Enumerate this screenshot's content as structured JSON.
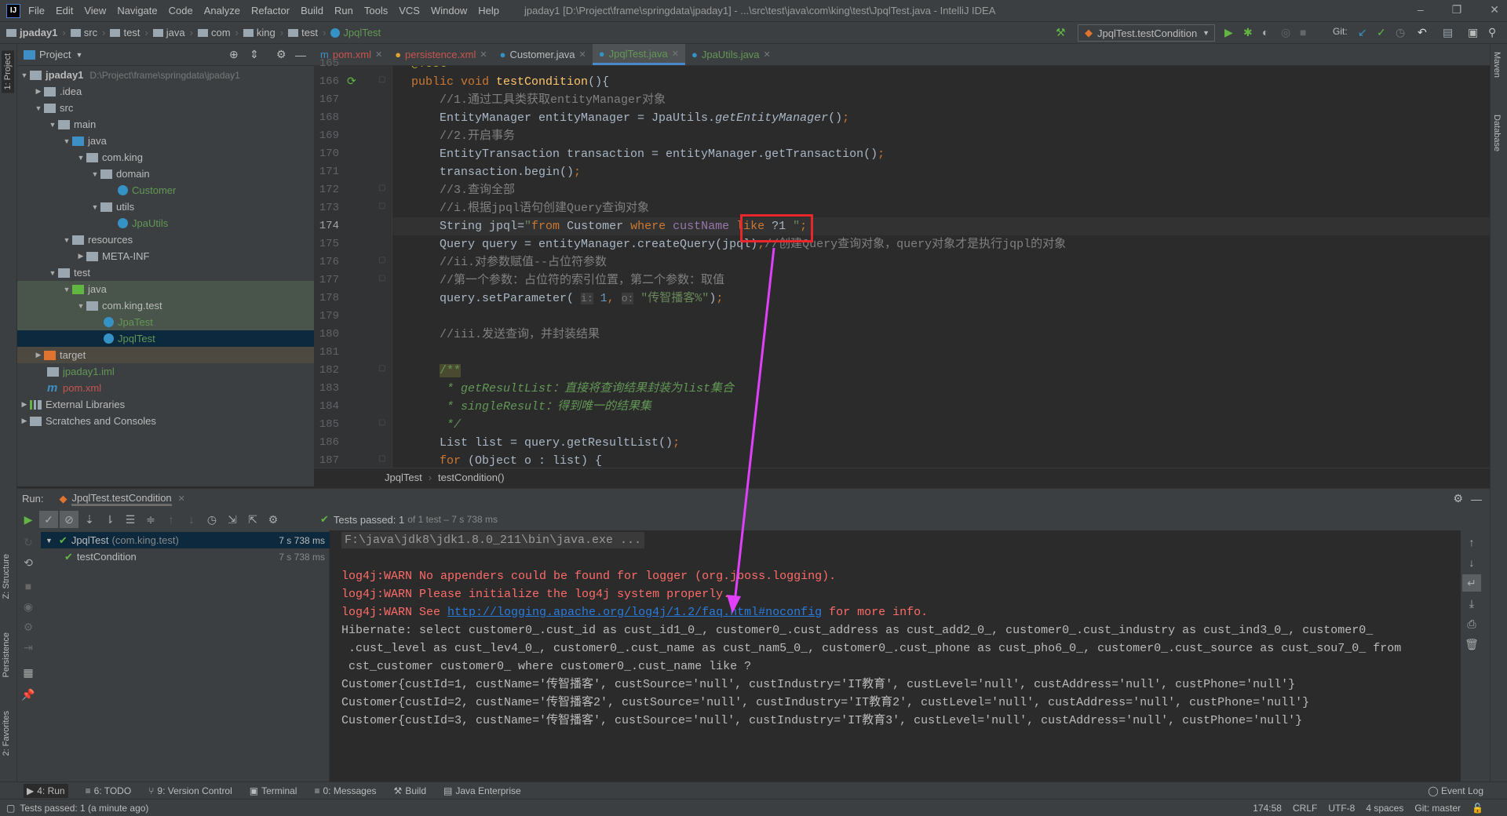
{
  "window": {
    "title": "jpaday1 [D:\\Project\\frame\\springdata\\jpaday1] - ...\\src\\test\\java\\com\\king\\test\\JpqlTest.java - IntelliJ IDEA",
    "logo": "IJ",
    "min": "–",
    "max": "❐",
    "close": "✕"
  },
  "menu": [
    "File",
    "Edit",
    "View",
    "Navigate",
    "Code",
    "Analyze",
    "Refactor",
    "Build",
    "Run",
    "Tools",
    "VCS",
    "Window",
    "Help"
  ],
  "navbar": {
    "crumbs": [
      "jpaday1",
      "src",
      "test",
      "java",
      "com",
      "king",
      "test",
      "JpqlTest"
    ],
    "run_config": "JpqlTest.testCondition",
    "git_label": "Git:"
  },
  "project": {
    "title": "Project",
    "tool_label": "1: Project",
    "tree": [
      {
        "label": "jpaday1",
        "extra": "D:\\Project\\frame\\springdata\\jpaday1",
        "depth": 0,
        "arrow": "▼",
        "icon": "folder",
        "color": "#bbbbbb",
        "bold": true
      },
      {
        "label": ".idea",
        "depth": 1,
        "arrow": "▶",
        "icon": "folder",
        "color": "#bbbbbb"
      },
      {
        "label": "src",
        "depth": 1,
        "arrow": "▼",
        "icon": "folder",
        "color": "#bbbbbb"
      },
      {
        "label": "main",
        "depth": 2,
        "arrow": "▼",
        "icon": "folder",
        "color": "#bbbbbb"
      },
      {
        "label": "java",
        "depth": 3,
        "arrow": "▼",
        "icon": "src",
        "color": "#bbbbbb"
      },
      {
        "label": "com.king",
        "depth": 4,
        "arrow": "▼",
        "icon": "folder",
        "color": "#bbbbbb"
      },
      {
        "label": "domain",
        "depth": 5,
        "arrow": "▼",
        "icon": "folder",
        "color": "#bbbbbb"
      },
      {
        "label": "Customer",
        "depth": 6,
        "arrow": "",
        "icon": "cls",
        "color": "#629755"
      },
      {
        "label": "utils",
        "depth": 5,
        "arrow": "▼",
        "icon": "folder",
        "color": "#bbbbbb"
      },
      {
        "label": "JpaUtils",
        "depth": 6,
        "arrow": "",
        "icon": "cls",
        "color": "#629755"
      },
      {
        "label": "resources",
        "depth": 3,
        "arrow": "▼",
        "icon": "folder",
        "color": "#bbbbbb"
      },
      {
        "label": "META-INF",
        "depth": 4,
        "arrow": "▶",
        "icon": "folder",
        "color": "#bbbbbb"
      },
      {
        "label": "test",
        "depth": 2,
        "arrow": "▼",
        "icon": "folder",
        "color": "#bbbbbb"
      },
      {
        "label": "java",
        "depth": 3,
        "arrow": "▼",
        "icon": "tst",
        "color": "#bbbbbb",
        "bg": "#49544a"
      },
      {
        "label": "com.king.test",
        "depth": 4,
        "arrow": "▼",
        "icon": "folder",
        "color": "#bbbbbb",
        "bg": "#49544a"
      },
      {
        "label": "JpaTest",
        "depth": 5,
        "arrow": "",
        "icon": "cls",
        "color": "#629755",
        "bg": "#49544a"
      },
      {
        "label": "JpqlTest",
        "depth": 5,
        "arrow": "",
        "icon": "cls",
        "color": "#629755",
        "bg": "#0d293e"
      },
      {
        "label": "target",
        "depth": 1,
        "arrow": "▶",
        "icon": "ex",
        "color": "#bbbbbb",
        "bg": "#4d4840"
      },
      {
        "label": "jpaday1.iml",
        "depth": 1,
        "arrow": "",
        "icon": "folder",
        "color": "#629755"
      },
      {
        "label": "pom.xml",
        "depth": 1,
        "arrow": "",
        "icon": "mvn",
        "color": "#c75450"
      },
      {
        "label": "External Libraries",
        "depth": 0,
        "arrow": "▶",
        "icon": "lib",
        "color": "#bbbbbb"
      },
      {
        "label": "Scratches and Consoles",
        "depth": 0,
        "arrow": "▶",
        "icon": "folder",
        "color": "#bbbbbb"
      }
    ]
  },
  "tabs": [
    {
      "label": "pom.xml",
      "color": "#c75450",
      "active": false
    },
    {
      "label": "persistence.xml",
      "color": "#c75450",
      "active": false
    },
    {
      "label": "Customer.java",
      "color": "#bbbbbb",
      "active": false
    },
    {
      "label": "JpqlTest.java",
      "color": "#629755",
      "active": true
    },
    {
      "label": "JpaUtils.java",
      "color": "#629755",
      "active": false
    }
  ],
  "editor": {
    "current_line": 174,
    "lines": [
      {
        "n": 165,
        "t": [
          [
            "a",
            "@Test"
          ]
        ]
      },
      {
        "n": 166,
        "t": [
          [
            "k",
            "public void "
          ],
          [
            "m",
            "testCondition"
          ],
          [
            "p",
            "(){"
          ]
        ]
      },
      {
        "n": 167,
        "t": [
          [
            "c",
            "    //1.通过工具类获取entityManager对象"
          ]
        ]
      },
      {
        "n": 168,
        "t": [
          [
            "p",
            "    EntityManager entityManager = JpaUtils."
          ],
          [
            "i",
            "getEntityManager"
          ],
          [
            "p",
            "()"
          ],
          [
            "k",
            ";"
          ]
        ]
      },
      {
        "n": 169,
        "t": [
          [
            "c",
            "    //2.开启事务"
          ]
        ]
      },
      {
        "n": 170,
        "t": [
          [
            "p",
            "    EntityTransaction transaction = entityManager.getTransaction()"
          ],
          [
            "k",
            ";"
          ]
        ]
      },
      {
        "n": 171,
        "t": [
          [
            "p",
            "    transaction.begin()"
          ],
          [
            "k",
            ";"
          ]
        ]
      },
      {
        "n": 172,
        "t": [
          [
            "c",
            "    //3.查询全部"
          ]
        ]
      },
      {
        "n": 173,
        "t": [
          [
            "c",
            "    //i.根据jpql语句创建Query查询对象"
          ]
        ]
      },
      {
        "n": 174,
        "t": [
          [
            "p",
            "    String jpql="
          ],
          [
            "s",
            "\""
          ],
          [
            "k",
            "from "
          ],
          [
            "p",
            "Customer "
          ],
          [
            "k",
            "where "
          ],
          [
            "f",
            "custName "
          ],
          [
            "k",
            "like "
          ],
          [
            "p",
            "?1 "
          ],
          [
            "s",
            "\""
          ],
          [
            "k",
            ";"
          ]
        ]
      },
      {
        "n": 175,
        "t": [
          [
            "p",
            "    Query query = entityManager.createQuery(jpql)"
          ],
          [
            "k",
            ";"
          ],
          [
            "c",
            "//创建Query查询对象，query对象才是执行jqpl的对象"
          ]
        ]
      },
      {
        "n": 176,
        "t": [
          [
            "c",
            "    //ii.对参数赋值--占位符参数"
          ]
        ]
      },
      {
        "n": 177,
        "t": [
          [
            "c",
            "    //第一个参数：占位符的索引位置，第二个参数：取值"
          ]
        ]
      },
      {
        "n": 178,
        "t": [
          [
            "p",
            "    query.setParameter( "
          ],
          [
            "h",
            "i:"
          ],
          [
            "n",
            " 1"
          ],
          [
            "k",
            ", "
          ],
          [
            "h",
            "o:"
          ],
          [
            "s",
            " \"传智播客%\""
          ],
          [
            "p",
            ")"
          ],
          [
            "k",
            ";"
          ]
        ]
      },
      {
        "n": 179,
        "t": []
      },
      {
        "n": 180,
        "t": [
          [
            "c",
            "    //iii.发送查询，并封装结果"
          ]
        ]
      },
      {
        "n": 181,
        "t": []
      },
      {
        "n": 182,
        "t": [
          [
            "p",
            "    "
          ],
          [
            "dk",
            "/**"
          ]
        ]
      },
      {
        "n": 183,
        "t": [
          [
            "d",
            "     * getResultList：直接将查询结果封装为list集合"
          ]
        ]
      },
      {
        "n": 184,
        "t": [
          [
            "d",
            "     * singleResult：得到唯一的结果集"
          ]
        ]
      },
      {
        "n": 185,
        "t": [
          [
            "d",
            "     */"
          ]
        ]
      },
      {
        "n": 186,
        "t": [
          [
            "p",
            "    List list = query.getResultList()"
          ],
          [
            "k",
            ";"
          ]
        ]
      },
      {
        "n": 187,
        "t": [
          [
            "k",
            "    for "
          ],
          [
            "p",
            "(Object o : list) {"
          ]
        ]
      }
    ],
    "breadcrumb": [
      "JpqlTest",
      "testCondition()"
    ]
  },
  "run": {
    "label": "Run:",
    "tab": "JpqlTest.testCondition",
    "status": "Tests passed: 1",
    "status_detail": "of 1 test – 7 s 738 ms",
    "tests": [
      {
        "name": "JpqlTest",
        "pkg": "(com.king.test)",
        "time": "7 s 738 ms",
        "depth": 0
      },
      {
        "name": "testCondition",
        "pkg": "",
        "time": "7 s 738 ms",
        "depth": 1
      }
    ],
    "console": [
      {
        "type": "cmd",
        "text": "F:\\java\\jdk8\\jdk1.8.0_211\\bin\\java.exe ..."
      },
      {
        "type": "plain",
        "text": ""
      },
      {
        "type": "red",
        "text": "log4j:WARN No appenders could be found for logger (org.jboss.logging)."
      },
      {
        "type": "red",
        "text": "log4j:WARN Please initialize the log4j system properly."
      },
      {
        "type": "link",
        "pre": "log4j:WARN See ",
        "link": "http://logging.apache.org/log4j/1.2/faq.html#noconfig",
        "post": " for more info."
      },
      {
        "type": "plain",
        "text": "Hibernate: select customer0_.cust_id as cust_id1_0_, customer0_.cust_address as cust_add2_0_, customer0_.cust_industry as cust_ind3_0_, customer0_"
      },
      {
        "type": "plain",
        "text": " .cust_level as cust_lev4_0_, customer0_.cust_name as cust_nam5_0_, customer0_.cust_phone as cust_pho6_0_, customer0_.cust_source as cust_sou7_0_ from"
      },
      {
        "type": "plain",
        "text": " cst_customer customer0_ where customer0_.cust_name like ?"
      },
      {
        "type": "plain",
        "text": "Customer{custId=1, custName='传智播客', custSource='null', custIndustry='IT教育', custLevel='null', custAddress='null', custPhone='null'}"
      },
      {
        "type": "plain",
        "text": "Customer{custId=2, custName='传智播客2', custSource='null', custIndustry='IT教育2', custLevel='null', custAddress='null', custPhone='null'}"
      },
      {
        "type": "plain",
        "text": "Customer{custId=3, custName='传智播客', custSource='null', custIndustry='IT教育3', custLevel='null', custAddress='null', custPhone='null'}"
      }
    ]
  },
  "bottom_tools": [
    "4: Run",
    "6: TODO",
    "9: Version Control",
    "Terminal",
    "0: Messages",
    "Build",
    "Java Enterprise"
  ],
  "event_log": "Event Log",
  "status": {
    "message": "Tests passed: 1 (a minute ago)",
    "position": "174:58",
    "line_sep": "CRLF",
    "encoding": "UTF-8",
    "indent": "4 spaces",
    "git": "Git: master"
  },
  "side_labels": {
    "structure": "Z: Structure",
    "persistence": "Persistence",
    "favorites": "2: Favorites",
    "maven": "Maven",
    "database": "Database"
  },
  "colors": {
    "annotation_box": "#e8262b",
    "annotation_arrow": "#e040fb",
    "accent": "#4a88c7"
  }
}
